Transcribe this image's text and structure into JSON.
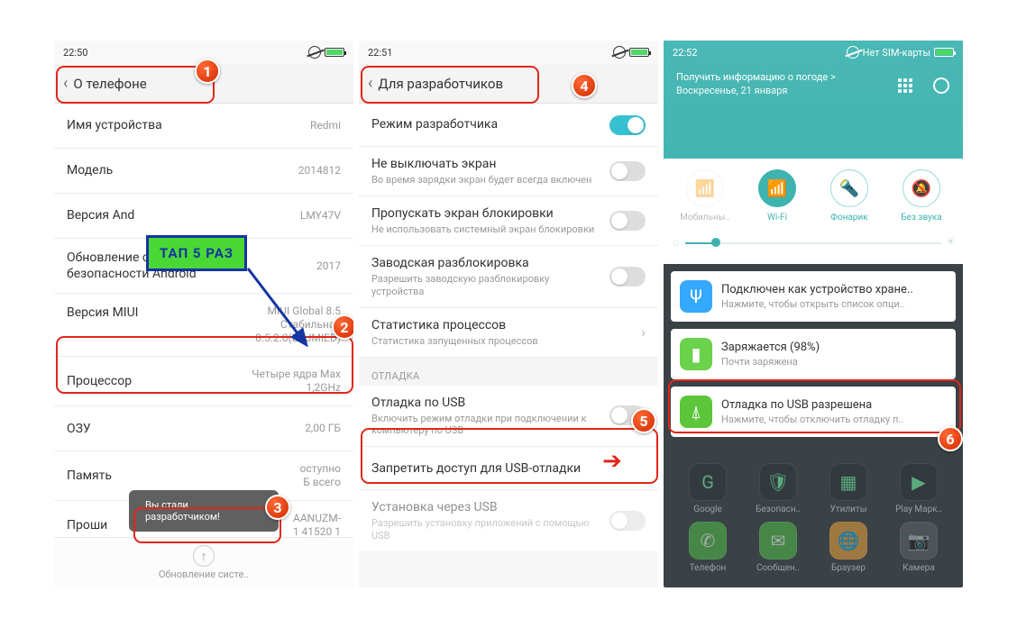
{
  "badges": {
    "b1": "1",
    "b2": "2",
    "b3": "3",
    "b4": "4",
    "b5": "5",
    "b6": "6"
  },
  "tap_label": "ТАП 5 РАЗ",
  "phone1": {
    "time": "22:50",
    "header": "О телефоне",
    "rows": {
      "device_name": {
        "label": "Имя устройства",
        "value": "Redmi"
      },
      "model": {
        "label": "Модель",
        "value": "2014812"
      },
      "android_ver": {
        "label": "Версия And",
        "value": "LMY47V"
      },
      "sec_patch": {
        "label": "Обновление системы безопасности Android",
        "value": "2017"
      },
      "miui_ver": {
        "label": "Версия MIUI",
        "value": "MIUI Global 8.5\nСтабильная\n8.5.2.0(LHJMIED)"
      },
      "cpu": {
        "label": "Процессор",
        "value": "Четыре ядра Max\n1,2GHz"
      },
      "ram": {
        "label": "ОЗУ",
        "value": "2,00 ГБ"
      },
      "storage": {
        "label": "Память",
        "value": "оступно\nБ всего"
      },
      "fw": {
        "label": "Проши",
        "value": "AANUZM-\n1 41520 1"
      }
    },
    "toast": "Вы стали разработчиком!",
    "update_bar": "Обновление систе.."
  },
  "phone2": {
    "time": "22:51",
    "header": "Для разработчиков",
    "r": {
      "devmode": {
        "title": "Режим разработчика"
      },
      "noscreenoff": {
        "title": "Не выключать экран",
        "sub": "Во время зарядки экран будет всегда включен"
      },
      "skiplock": {
        "title": "Пропускать экран блокировки",
        "sub": "Не использовать системный экран блокировки"
      },
      "oemunlock": {
        "title": "Заводская разблокировка",
        "sub": "Разрешить заводскую разблокировку устройства"
      },
      "procstats": {
        "title": "Статистика процессов",
        "sub": "Статистика запущенных процессов"
      },
      "section": "ОТЛАДКА",
      "usbdebug": {
        "title": "Отладка по USB",
        "sub": "Включить режим отладки при подключении к компьютеру по USB"
      },
      "revoke": {
        "title": "Запретить доступ для USB-отладки"
      },
      "usbinstall": {
        "title": "Установка через USB",
        "sub": "Разрешить установку приложений с помощью USB"
      }
    }
  },
  "phone3": {
    "time": "22:52",
    "sim": "Нет SIM-карты",
    "weather_line": "Получить информацию о погоде >",
    "date": "Воскресенье, 21 января",
    "qs": {
      "mobile": "Мобильны..",
      "wifi": "Wi-Fi",
      "torch": "Фонарик",
      "silent": "Без звука"
    },
    "notifs": {
      "usb": {
        "title": "Подключен как устройство хране..",
        "sub": "Нажмите, чтобы открыть список опци.."
      },
      "charge": {
        "title": "Заряжается (98%)",
        "sub": "Почти заряжена"
      },
      "debug": {
        "title": "Отладка по USB разрешена",
        "sub": "Нажмите, чтобы отключить отладку п.."
      }
    },
    "apps": {
      "google": "Google",
      "security": "Безопасн..",
      "util": "Утилиты",
      "play": "Play Марк..",
      "phone": "Телефон",
      "msg": "Сообщен..",
      "browser": "Браузер",
      "camera": "Камера"
    }
  }
}
